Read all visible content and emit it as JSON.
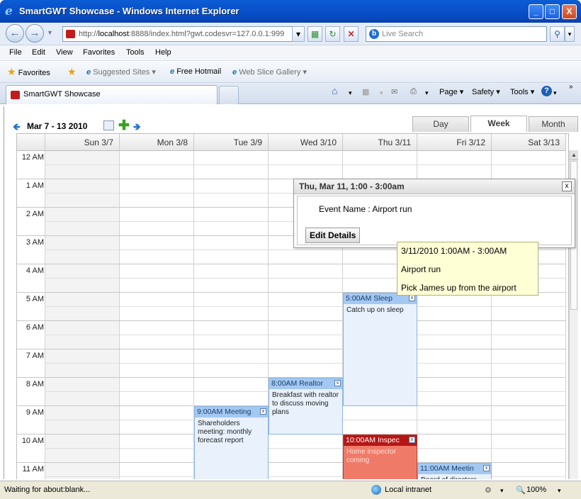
{
  "window": {
    "title": "SmartGWT Showcase - Windows Internet Explorer",
    "min": "_",
    "max": "□",
    "close": "X"
  },
  "nav": {
    "url_prefix": "http://",
    "url_host": "localhost",
    "url_rest": ":8888/index.html?gwt.codesvr=127.0.0.1:999",
    "search_placeholder": "Live Search"
  },
  "menu": [
    "File",
    "Edit",
    "View",
    "Favorites",
    "Tools",
    "Help"
  ],
  "favorites": {
    "label": "Favorites",
    "items": [
      "Suggested Sites ▾",
      "Free Hotmail",
      "Web Slice Gallery ▾"
    ]
  },
  "tab": {
    "label": "SmartGWT Showcase"
  },
  "commands": [
    "Page ▾",
    "Safety ▾",
    "Tools ▾"
  ],
  "calendar": {
    "date_range": "Mar 7 - 13 2010",
    "view_tabs": [
      {
        "label": "Day",
        "selected": false
      },
      {
        "label": "Week",
        "selected": true
      },
      {
        "label": "Month",
        "selected": false
      }
    ],
    "days": [
      "Sun 3/7",
      "Mon 3/8",
      "Tue 3/9",
      "Wed 3/10",
      "Thu 3/11",
      "Fri 3/12",
      "Sat 3/13"
    ],
    "hours": [
      "12 AM",
      "1 AM",
      "2 AM",
      "3 AM",
      "4 AM",
      "5 AM",
      "6 AM",
      "7 AM",
      "8 AM",
      "9 AM",
      "10 AM",
      "11 AM"
    ],
    "events": [
      {
        "title": "5:00AM Sleep",
        "desc": "Catch up on sleep",
        "day": 4,
        "start": 5,
        "end": 9,
        "color": "#a3c8f2"
      },
      {
        "title": "8:00AM Realtor",
        "desc": "Breakfast with realtor to discuss moving plans",
        "day": 3,
        "start": 8,
        "end": 10,
        "color": "#a3c8f2"
      },
      {
        "title": "9:00AM Meeting",
        "desc": "Shareholders meeting: monthly forecast report",
        "day": 2,
        "start": 9,
        "end": 12,
        "color": "#a3c8f2"
      },
      {
        "title": "10:00AM Inspec",
        "desc": "Home inspector coming",
        "day": 4,
        "start": 10,
        "end": 12,
        "color": "#b51616"
      },
      {
        "title": "11:00AM Meetin",
        "desc": "Board of directors",
        "day": 5,
        "start": 11,
        "end": 12,
        "color": "#a3c8f2"
      }
    ],
    "close_glyph": "x"
  },
  "popup": {
    "title": "Thu, Mar 11, 1:00 - 3:00am",
    "field_label": "Event Name",
    "field_value": "Airport run",
    "button": "Edit Details",
    "close": "x"
  },
  "tooltip": {
    "time": "3/11/2010 1:00AM - 3:00AM",
    "name": "Airport run",
    "desc": "Pick James up from the airport"
  },
  "status": {
    "text": "Waiting for about:blank...",
    "zone": "Local intranet",
    "zoom": "100%"
  }
}
